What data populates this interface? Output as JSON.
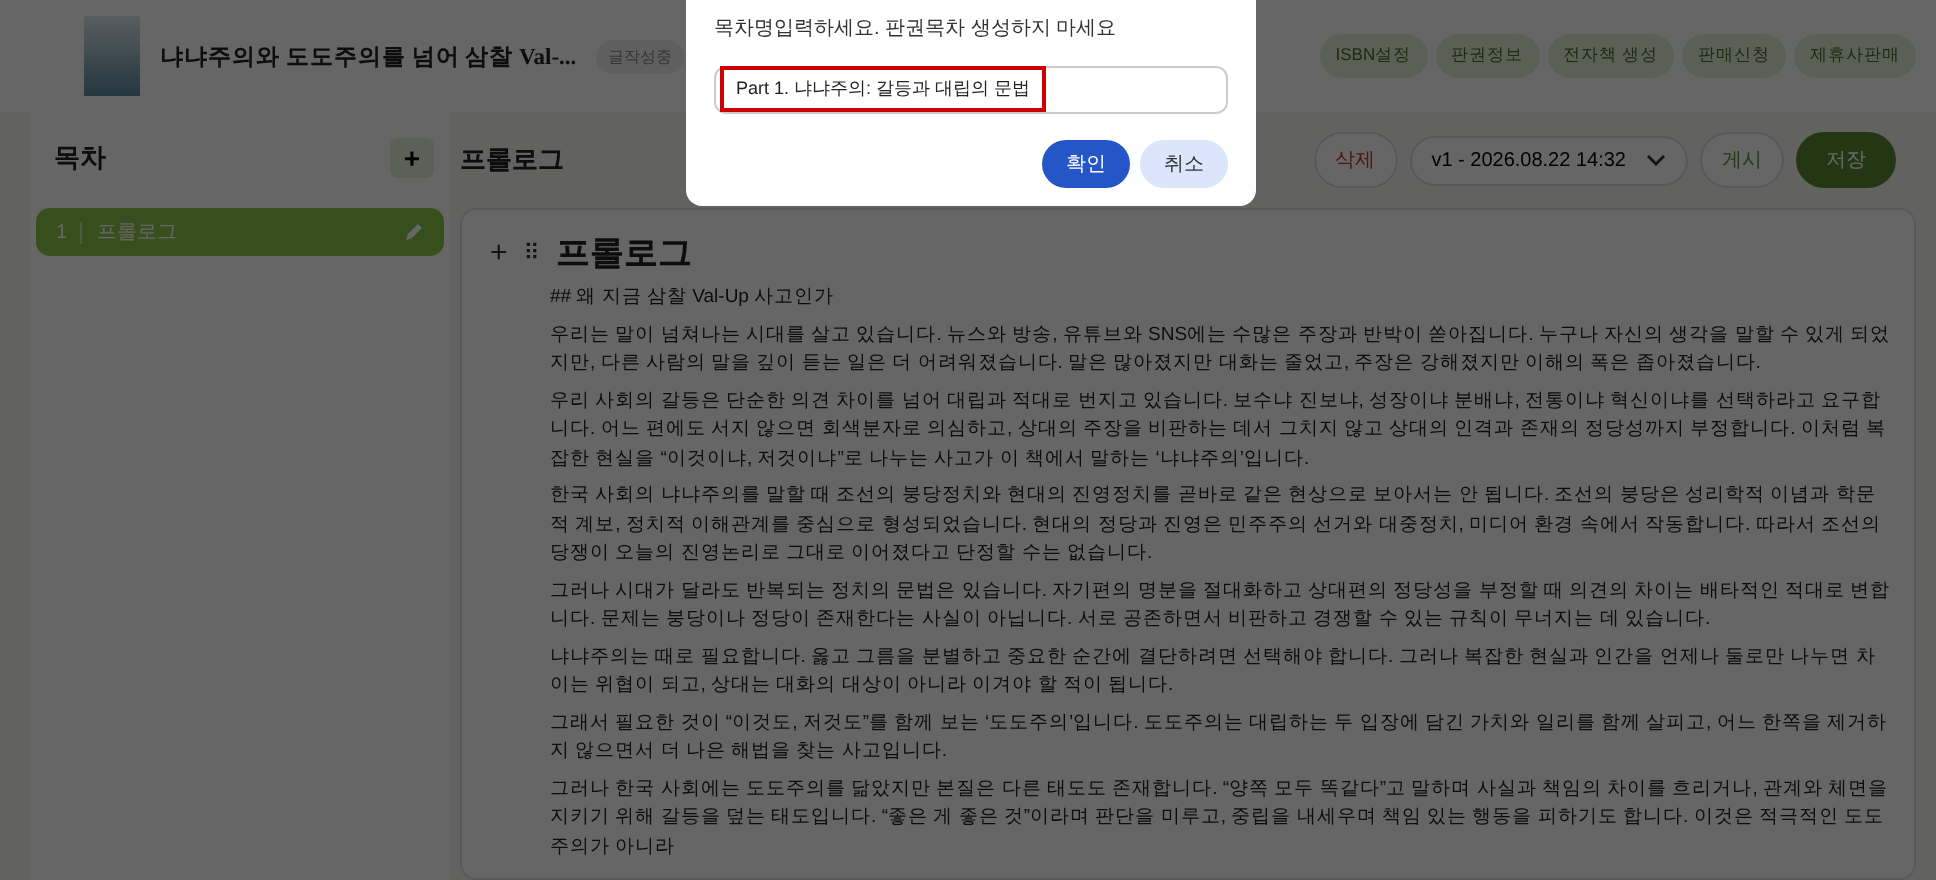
{
  "header": {
    "title": "냐냐주의와 도도주의를 넘어 삼찰 Val-...",
    "status_badge": "글작성중",
    "tabs": [
      {
        "label": "ISBN설정",
        "selected": false
      },
      {
        "label": "판권정보",
        "selected": false
      },
      {
        "label": "전자책 생성",
        "selected": false
      },
      {
        "label": "판매신청",
        "selected": false
      },
      {
        "label": "제휴사판매",
        "selected": false
      }
    ]
  },
  "sidebar": {
    "title": "목차",
    "add_button": "+",
    "items": [
      {
        "number": "1",
        "label": "프롤로그",
        "selected": true
      }
    ]
  },
  "editor": {
    "chapter_title": "프롤로그",
    "delete_button": "삭제",
    "version": "v1 - 2026.08.22 14:32",
    "publish_button": "게시",
    "save_button": "저장",
    "block_add": "+",
    "block_handle": "⠿",
    "heading": "프롤로그",
    "paragraphs": [
      "## 왜 지금 삼찰 Val-Up 사고인가",
      "우리는 말이 넘쳐나는 시대를 살고 있습니다. 뉴스와 방송, 유튜브와 SNS에는 수많은 주장과 반박이 쏟아집니다. 누구나 자신의 생각을 말할 수 있게 되었지만, 다른 사람의 말을 깊이 듣는 일은 더 어려워졌습니다. 말은 많아졌지만 대화는 줄었고, 주장은 강해졌지만 이해의 폭은 좁아졌습니다.",
      "우리 사회의 갈등은 단순한 의견 차이를 넘어 대립과 적대로 번지고 있습니다. 보수냐 진보냐, 성장이냐 분배냐, 전통이냐 혁신이냐를 선택하라고 요구합니다. 어느 편에도 서지 않으면 회색분자로 의심하고, 상대의 주장을 비판하는 데서 그치지 않고 상대의 인격과 존재의 정당성까지 부정합니다. 이처럼 복잡한 현실을 “이것이냐, 저것이냐”로 나누는 사고가 이 책에서 말하는 ‘냐냐주의’입니다.",
      "한국 사회의 냐냐주의를 말할 때 조선의 붕당정치와 현대의 진영정치를 곧바로 같은 현상으로 보아서는 안 됩니다. 조선의 붕당은 성리학적 이념과 학문적 계보, 정치적 이해관계를 중심으로 형성되었습니다. 현대의 정당과 진영은 민주주의 선거와 대중정치, 미디어 환경 속에서 작동합니다. 따라서 조선의 당쟁이 오늘의 진영논리로 그대로 이어졌다고 단정할 수는 없습니다.",
      "그러나 시대가 달라도 반복되는 정치의 문법은 있습니다. 자기편의 명분을 절대화하고 상대편의 정당성을 부정할 때 의견의 차이는 배타적인 적대로 변합니다. 문제는 붕당이나 정당이 존재한다는 사실이 아닙니다. 서로 공존하면서 비판하고 경쟁할 수 있는 규칙이 무너지는 데 있습니다.",
      "냐냐주의는 때로 필요합니다. 옳고 그름을 분별하고 중요한 순간에 결단하려면 선택해야 합니다. 그러나 복잡한 현실과 인간을 언제나 둘로만 나누면 차이는 위협이 되고, 상대는 대화의 대상이 아니라 이겨야 할 적이 됩니다.",
      "그래서 필요한 것이 “이것도, 저것도”를 함께 보는 ‘도도주의’입니다. 도도주의는 대립하는 두 입장에 담긴 가치와 일리를 함께 살피고, 어느 한쪽을 제거하지 않으면서 더 나은 해법을 찾는 사고입니다.",
      "그러나 한국 사회에는 도도주의를 닮았지만 본질은 다른 태도도 존재합니다. “양쪽 모두 똑같다”고 말하며 사실과 책임의 차이를 흐리거나, 관계와 체면을 지키기 위해 갈등을 덮는 태도입니다. “좋은 게 좋은 것”이라며 판단을 미루고, 중립을 내세우며 책임 있는 행동을 피하기도 합니다. 이것은 적극적인 도도주의가 아니라"
    ]
  },
  "dialog": {
    "message": "목차명입력하세요.  판권목차 생성하지 마세요",
    "input_value": "Part 1. 냐냐주의: 갈등과 대립의 문법",
    "input_highlighted": true,
    "confirm_button": "확인",
    "cancel_button": "취소"
  }
}
